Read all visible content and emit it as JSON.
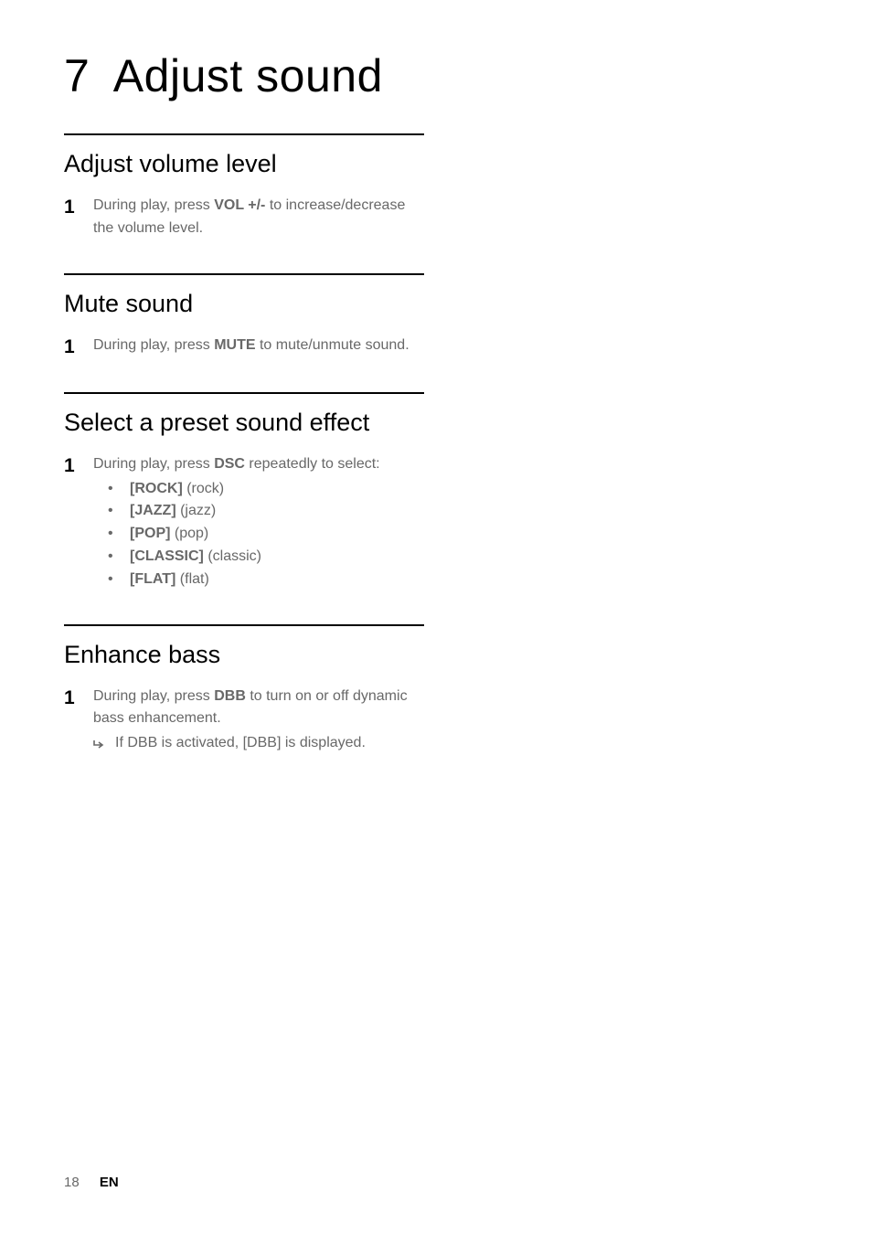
{
  "page": {
    "title": "7 Adjust sound"
  },
  "sections": {
    "volume": {
      "title": "Adjust volume level",
      "step_num": "1",
      "text_a": "During play, press ",
      "bold": "VOL +/-",
      "text_b": " to increase/decrease the volume level."
    },
    "mute": {
      "title": "Mute sound",
      "step_num": "1",
      "text_a": "During play, press ",
      "bold": "MUTE",
      "text_b": " to mute/unmute sound."
    },
    "preset": {
      "title": "Select a preset sound effect",
      "step_num": "1",
      "text_a": "During play, press ",
      "bold": "DSC",
      "text_b": " repeatedly to select:",
      "options": [
        {
          "bold": "[ROCK]",
          "desc": " (rock)"
        },
        {
          "bold": "[JAZZ]",
          "desc": " (jazz)"
        },
        {
          "bold": "[POP]",
          "desc": " (pop)"
        },
        {
          "bold": "[CLASSIC]",
          "desc": " (classic)"
        },
        {
          "bold": "[FLAT]",
          "desc": " (flat)"
        }
      ]
    },
    "bass": {
      "title": "Enhance bass",
      "step_num": "1",
      "text_a": "During play, press ",
      "bold": "DBB",
      "text_b": " to turn on or off dynamic bass enhancement.",
      "result": "If DBB is activated, [DBB] is displayed."
    }
  },
  "footer": {
    "page_number": "18",
    "lang": "EN"
  }
}
